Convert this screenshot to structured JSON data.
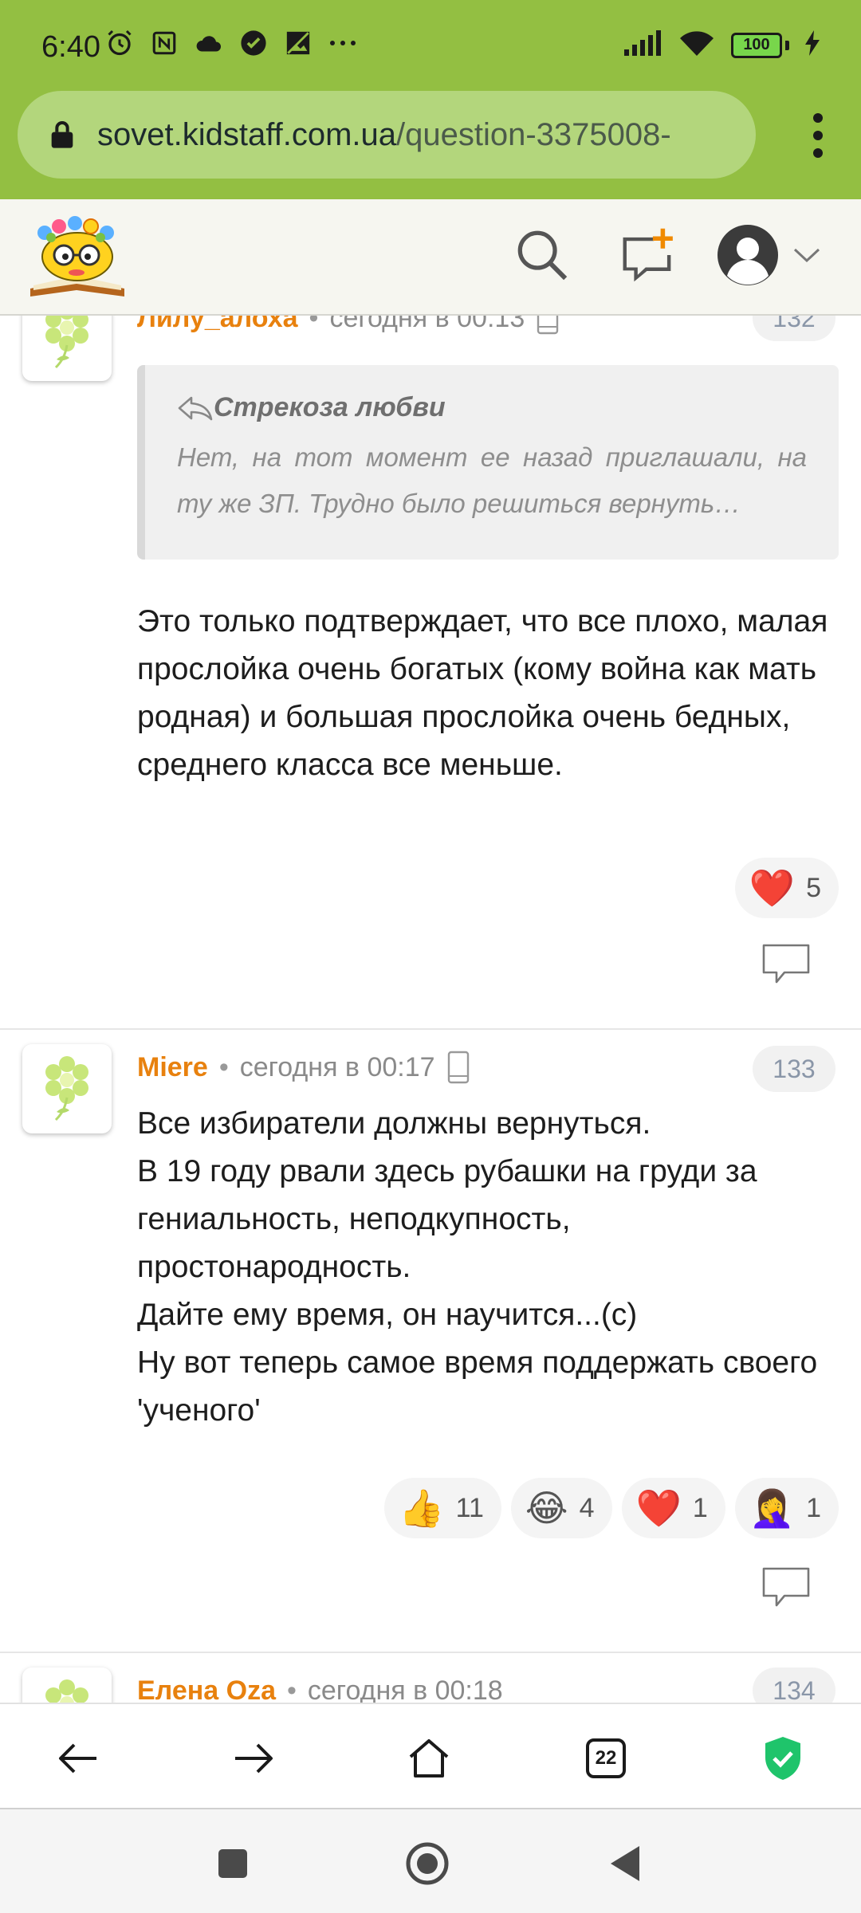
{
  "status_bar": {
    "time": "6:40",
    "battery": "100"
  },
  "browser": {
    "url_host": "sovet.kidstaff.com.ua",
    "url_path": "/question-3375008-",
    "tab_count": "22"
  },
  "comments": [
    {
      "author": "Лилу_алоха",
      "time": "сегодня в 00:13",
      "number": "132",
      "quote_author": "Стрекоза любви",
      "quote_text": "Нет, на тот момент ее назад приглашали, на ту же ЗП. Трудно было решиться вернуть…",
      "text": "Это только подтверждает, что все плохо, малая прослойка очень богатых (кому война как мать родная) и большая прослойка очень бедных, среднего класса все меньше.",
      "reactions": [
        {
          "emoji": "❤️",
          "count": "5"
        }
      ]
    },
    {
      "author": "Miere",
      "time": "сегодня в 00:17",
      "number": "133",
      "text": "Все избиратели должны вернуться.\nВ 19 году рвали здесь рубашки на груди за гениальность, неподкупность, простонародность.\nДайте ему время, он научится...(с)\nНу вот теперь самое время поддержать своего 'ученого'",
      "reactions": [
        {
          "emoji": "👍",
          "count": "11"
        },
        {
          "emoji": "😂",
          "count": "4"
        },
        {
          "emoji": "❤️",
          "count": "1"
        },
        {
          "emoji": "🤦‍♀️",
          "count": "1"
        }
      ]
    },
    {
      "author": "Елена Oza",
      "time": "сегодня в 00:18",
      "number": "134"
    }
  ],
  "colors": {
    "status_bg": "#93bf42",
    "url_bg": "#b3d67c",
    "author": "#e8810e",
    "shield": "#1fc46b"
  }
}
